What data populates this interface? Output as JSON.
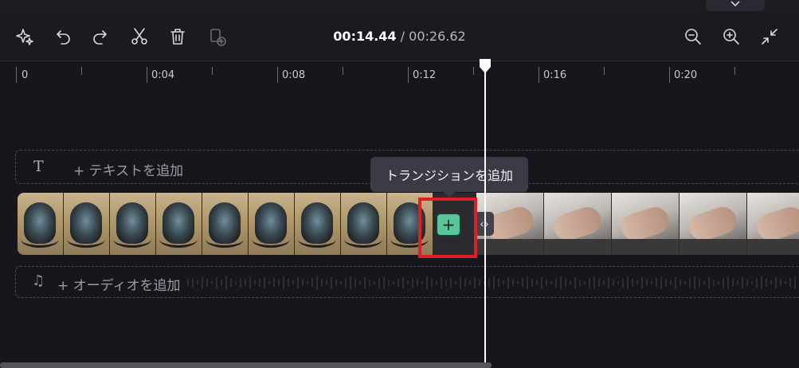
{
  "toolbar": {
    "current_time": "00:14.44",
    "separator": " / ",
    "total_time": "00:26.62"
  },
  "ruler": {
    "labels": [
      "0",
      "0:04",
      "0:08",
      "0:12",
      "0:16",
      "0:20"
    ]
  },
  "tracks": {
    "text_add_label": "+ テキストを追加",
    "audio_add_label": "+ オーディオを追加"
  },
  "transition": {
    "tooltip": "トランジションを追加",
    "badge_symbol": "+",
    "handle_symbol": "‹›"
  },
  "icons": {
    "magic": "sparkle-icon",
    "undo": "undo-icon",
    "redo": "redo-icon",
    "split": "scissors-icon",
    "delete": "trash-icon",
    "duplicate": "duplicate-icon",
    "zoom_out": "zoom-out-icon",
    "zoom_in": "zoom-in-icon",
    "fit": "collapse-icon",
    "text": "text-icon",
    "music": "music-note-icon",
    "expand": "chevron-down-icon"
  },
  "colors": {
    "background": "#17161d",
    "transition_green": "#5ac49a",
    "highlight_red": "#e01e25",
    "playhead": "#ffffff"
  }
}
